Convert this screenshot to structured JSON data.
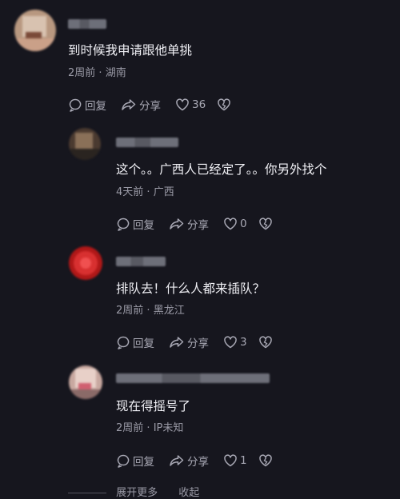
{
  "comments": [
    {
      "text": "到时候我申请跟他单挑",
      "time": "2周前",
      "location": "湖南",
      "reply_label": "回复",
      "share_label": "分享",
      "likes": "36"
    },
    {
      "text": "这个。。广西人已经定了。。你另外找个",
      "time": "4天前",
      "location": "广西",
      "reply_label": "回复",
      "share_label": "分享",
      "likes": "0"
    },
    {
      "text": "排队去！什么人都来插队？",
      "time": "2周前",
      "location": "黑龙江",
      "reply_label": "回复",
      "share_label": "分享",
      "likes": "3"
    },
    {
      "text": "现在得摇号了",
      "time": "2周前",
      "location": "IP未知",
      "reply_label": "回复",
      "share_label": "分享",
      "likes": "1"
    }
  ],
  "meta_separator": "·",
  "footer": {
    "expand_label": "展开更多",
    "collapse_label": "收起"
  },
  "colors": {
    "background": "#16161e",
    "text": "#f0f0f5",
    "secondary": "#9a9aa6"
  },
  "icons": [
    "reply-icon",
    "share-icon",
    "heart-icon",
    "broken-heart-icon"
  ]
}
